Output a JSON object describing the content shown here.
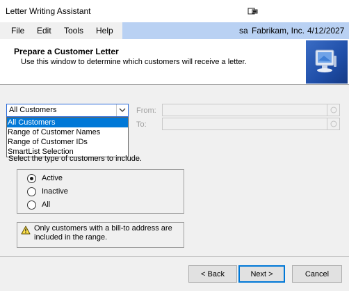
{
  "window": {
    "title": "Letter Writing Assistant",
    "icon": "window-restore-icon"
  },
  "menu": {
    "items": [
      "File",
      "Edit",
      "Tools",
      "Help"
    ],
    "user": "sa",
    "company": "Fabrikam, Inc.",
    "date": "4/12/2027"
  },
  "header": {
    "title": "Prepare a Customer Letter",
    "description": "Use this window to determine which customers will receive a letter.",
    "art_icon": "monitor-icon"
  },
  "range": {
    "selected": "All Customers",
    "options": [
      "All Customers",
      "Range of Customer Names",
      "Range of Customer IDs",
      "SmartList Selection"
    ],
    "from_label": "From:",
    "to_label": "To:",
    "from_value": "",
    "to_value": ""
  },
  "customer_type": {
    "label": "Select the type of customers to include.",
    "options": [
      "Active",
      "Inactive",
      "All"
    ],
    "selected": "Active"
  },
  "note": {
    "icon": "warning-icon",
    "text": "Only customers with a bill-to address are included in the range."
  },
  "buttons": {
    "back": "< Back",
    "next": "Next >",
    "cancel": "Cancel"
  },
  "colors": {
    "menu_info_bg": "#b9d1f3",
    "selection": "#0078d7",
    "header_art": "#1f4ea8"
  }
}
